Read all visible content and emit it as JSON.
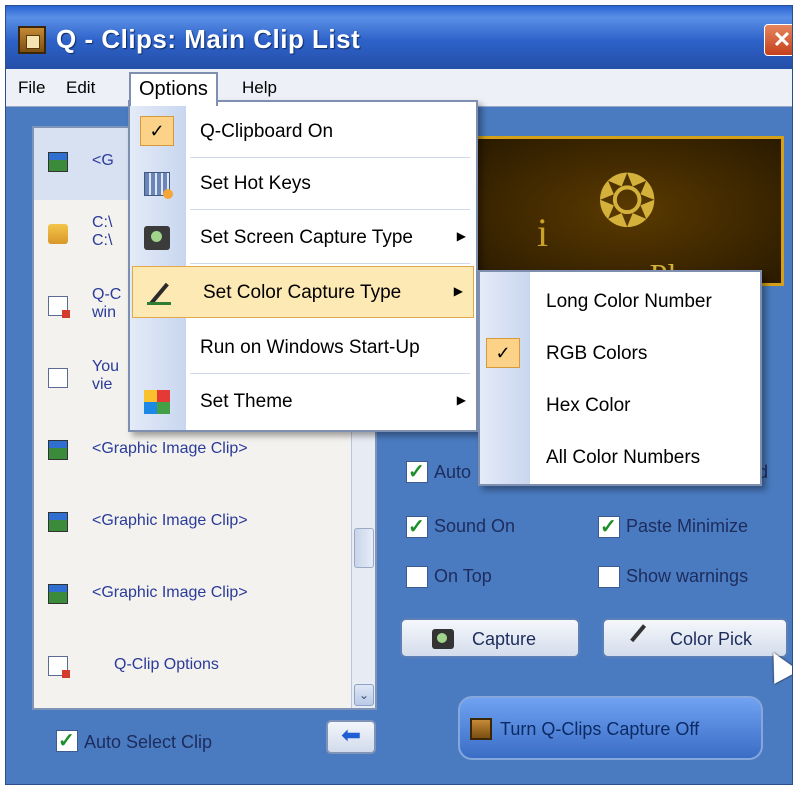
{
  "window": {
    "title": "Q - Clips:  Main Clip List",
    "close_glyph": "✕"
  },
  "menubar": {
    "file": "File",
    "edit": "Edit",
    "options": "Options",
    "help": "Help"
  },
  "options_menu": {
    "items": [
      {
        "label": "Q-Clipboard On",
        "checked": true,
        "icon": "check-icon"
      },
      {
        "label": "Set Hot Keys",
        "icon": "keyboard-icon"
      },
      {
        "label": "Set Screen Capture Type",
        "submenu": true,
        "icon": "camera-icon"
      },
      {
        "label": "Set Color Capture Type",
        "submenu": true,
        "highlighted": true,
        "icon": "eyedropper-icon"
      },
      {
        "label": "Run on Windows Start-Up",
        "icon": ""
      },
      {
        "label": "Set Theme",
        "submenu": true,
        "icon": "theme-icon"
      }
    ],
    "arrow_glyph": "▶",
    "check_glyph": "✓"
  },
  "color_submenu": {
    "items": [
      {
        "label": "Long Color Number"
      },
      {
        "label": "RGB Colors",
        "checked": true
      },
      {
        "label": "Hex Color"
      },
      {
        "label": "All Color Numbers"
      }
    ]
  },
  "clip_list": {
    "items": [
      {
        "text": "<G",
        "type": "image"
      },
      {
        "text": "C:\\\nC:\\",
        "type": "folder"
      },
      {
        "text": "Q-C\nwin",
        "type": "doc"
      },
      {
        "text": "You\nvie",
        "type": "doc"
      },
      {
        "text": "<Graphic Image Clip>",
        "type": "image"
      },
      {
        "text": "<Graphic Image Clip>",
        "type": "image"
      },
      {
        "text": "<Graphic Image Clip>",
        "type": "image"
      },
      {
        "text": "Q-Clip Options",
        "type": "doc"
      }
    ],
    "scroll_down_glyph": "⌄"
  },
  "options": {
    "auto_prefix": "Auto",
    "auto_suffix": "d",
    "sound_on": "Sound On",
    "paste_minimize": "Paste Minimize",
    "on_top": "On Top",
    "show_warnings": "Show warnings"
  },
  "buttons": {
    "capture": "Capture",
    "color_pick": "Color Pick",
    "turn_off": "Turn Q-Clips Capture Off",
    "auto_select": "Auto Select Clip",
    "arrow_glyph": "⬅"
  },
  "preview": {
    "text": "proPlus"
  }
}
